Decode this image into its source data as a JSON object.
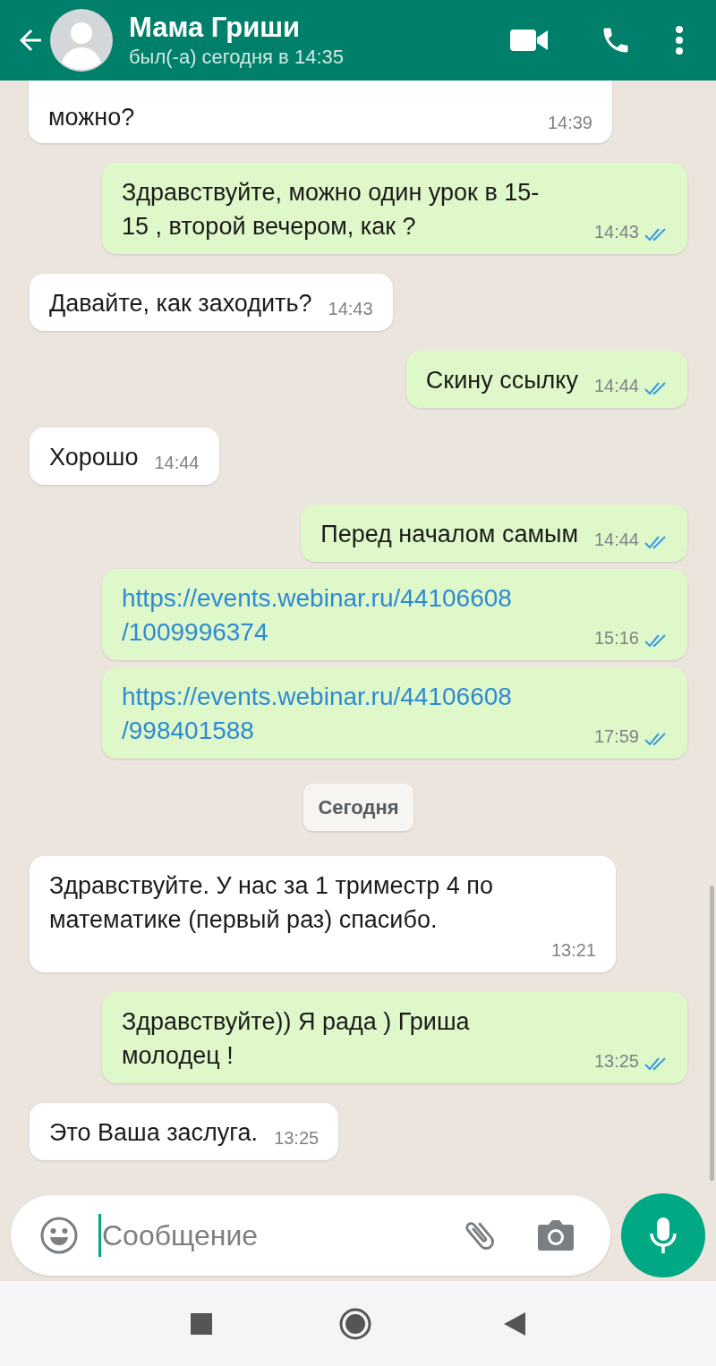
{
  "header": {
    "title": "Мама Гриши",
    "subtitle": "был(-а) сегодня в 14:35"
  },
  "messages": [
    {
      "kind": "text",
      "outgoing": false,
      "text": "можно?",
      "time": "14:39",
      "cut": true
    },
    {
      "kind": "text",
      "outgoing": true,
      "text": "Здравствуйте, можно один урок в 15-15 , второй вечером, как ?",
      "time": "14:43",
      "read": true
    },
    {
      "kind": "text",
      "outgoing": false,
      "text": "Давайте, как заходить?",
      "time": "14:43"
    },
    {
      "kind": "text",
      "outgoing": true,
      "text": "Скину ссылку",
      "time": "14:44",
      "read": true
    },
    {
      "kind": "text",
      "outgoing": false,
      "text": "Хорошо",
      "time": "14:44"
    },
    {
      "kind": "text",
      "outgoing": true,
      "text": "Перед началом самым",
      "time": "14:44",
      "read": true
    },
    {
      "kind": "link",
      "outgoing": true,
      "text": "https://events.webinar.ru/44106608/1009996374",
      "time": "15:16",
      "read": true
    },
    {
      "kind": "link",
      "outgoing": true,
      "text": "https://events.webinar.ru/44106608/998401588",
      "time": "17:59",
      "read": true
    },
    {
      "kind": "date",
      "text": "Сегодня"
    },
    {
      "kind": "text",
      "outgoing": false,
      "text": "Здравствуйте. У нас за 1 триместр 4 по математике (первый раз) спасибо.",
      "time": "13:21"
    },
    {
      "kind": "text",
      "outgoing": true,
      "text": "Здравствуйте)) Я рада ) Гриша молодец !",
      "time": "13:25",
      "read": true
    },
    {
      "kind": "text",
      "outgoing": false,
      "text": "Это Ваша заслуга.",
      "time": "13:25"
    }
  ],
  "composer": {
    "placeholder": "Сообщение"
  }
}
